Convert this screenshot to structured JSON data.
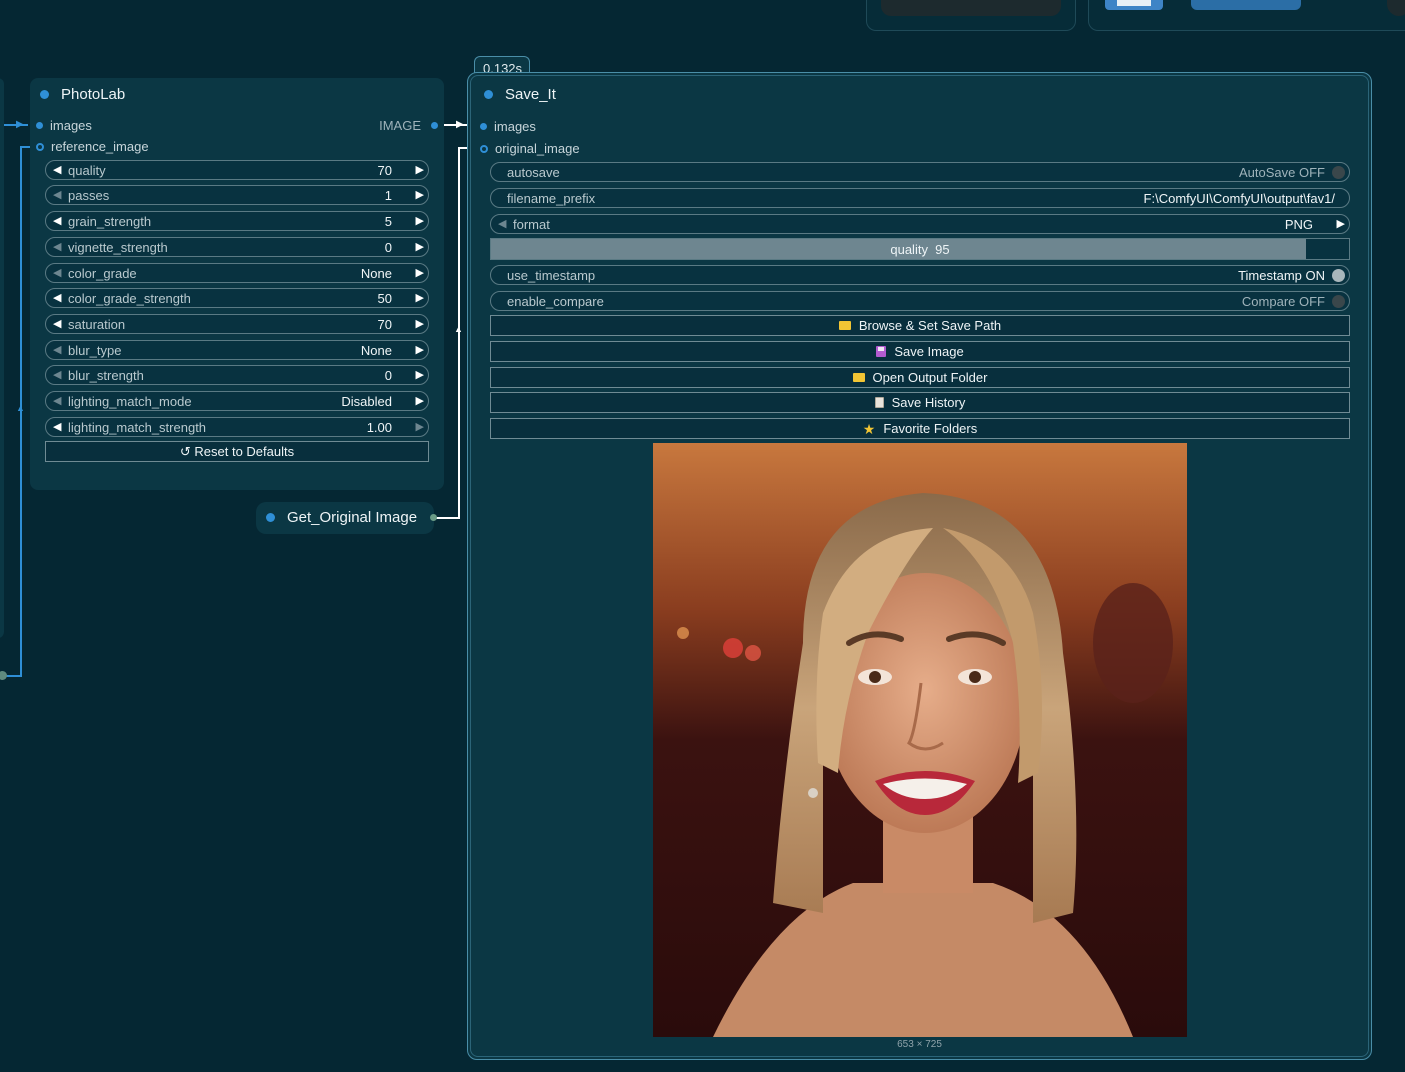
{
  "photolab": {
    "title": "PhotoLab",
    "inputs": [
      "images",
      "reference_image"
    ],
    "output": "IMAGE",
    "widgets": [
      {
        "label": "quality",
        "value": "70"
      },
      {
        "label": "passes",
        "value": "1"
      },
      {
        "label": "grain_strength",
        "value": "5"
      },
      {
        "label": "vignette_strength",
        "value": "0"
      },
      {
        "label": "color_grade",
        "value": "None"
      },
      {
        "label": "color_grade_strength",
        "value": "50"
      },
      {
        "label": "saturation",
        "value": "70"
      },
      {
        "label": "blur_type",
        "value": "None"
      },
      {
        "label": "blur_strength",
        "value": "0"
      },
      {
        "label": "lighting_match_mode",
        "value": "Disabled"
      },
      {
        "label": "lighting_match_strength",
        "value": "1.00"
      }
    ],
    "reset_label": "↺ Reset to Defaults"
  },
  "get_original": {
    "title": "Get_Original Image"
  },
  "save_it": {
    "timing": "0.132s",
    "title": "Save_It",
    "inputs": [
      "images",
      "original_image"
    ],
    "autosave": {
      "label": "autosave",
      "value": "AutoSave OFF"
    },
    "filename_prefix": {
      "label": "filename_prefix",
      "value": "F:\\ComfyUI\\ComfyUI\\output\\fav1/"
    },
    "format": {
      "label": "format",
      "value": "PNG"
    },
    "quality": {
      "label": "quality",
      "value": "95",
      "fraction": 0.95
    },
    "use_timestamp": {
      "label": "use_timestamp",
      "value": "Timestamp ON"
    },
    "enable_compare": {
      "label": "enable_compare",
      "value": "Compare OFF"
    },
    "buttons": [
      "Browse & Set Save Path",
      "Save Image",
      "Open Output Folder",
      "Save History",
      "Favorite Folders"
    ],
    "image_size": "653 × 725"
  },
  "colors": {
    "background": "#052733",
    "node": "#0b3744",
    "accent": "#2f8fd6"
  }
}
